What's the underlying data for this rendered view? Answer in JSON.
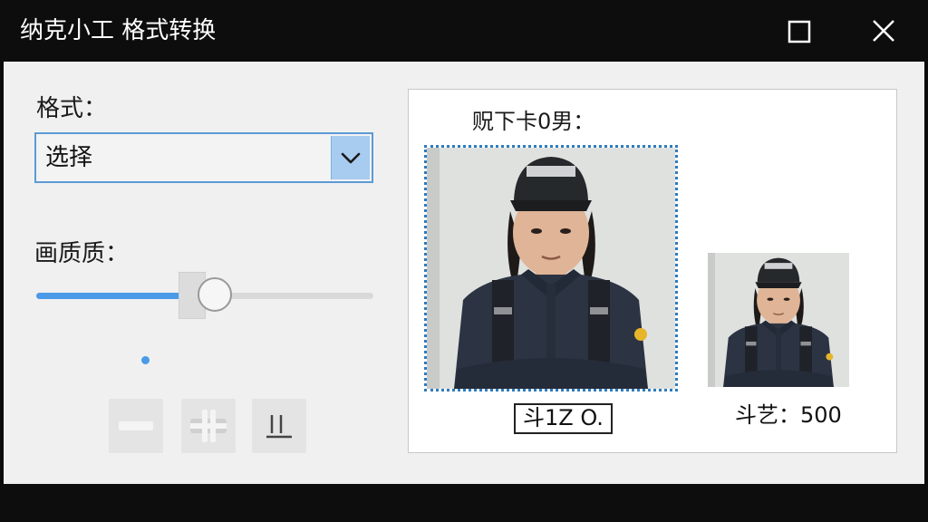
{
  "window": {
    "title": "纳克小工 格式转换",
    "maximize_icon": "maximize-icon",
    "close_icon": "close-icon"
  },
  "format": {
    "label": "格式：",
    "selected": "选择"
  },
  "quality": {
    "label": "画质质：",
    "value": 0.53
  },
  "tools": [
    {
      "name": "minus-icon"
    },
    {
      "name": "compress-icon"
    },
    {
      "name": "crop-icon"
    }
  ],
  "preview": {
    "caption": "贶下卡0男：",
    "original_size": "斗1Z O.",
    "converted_size": "斗艺：500"
  },
  "colors": {
    "accent": "#4a9ae8",
    "select_arrow_bg": "#a8ccf0",
    "selection_outline": "#2e7bbf",
    "titlebar": "#0d0d0d"
  }
}
